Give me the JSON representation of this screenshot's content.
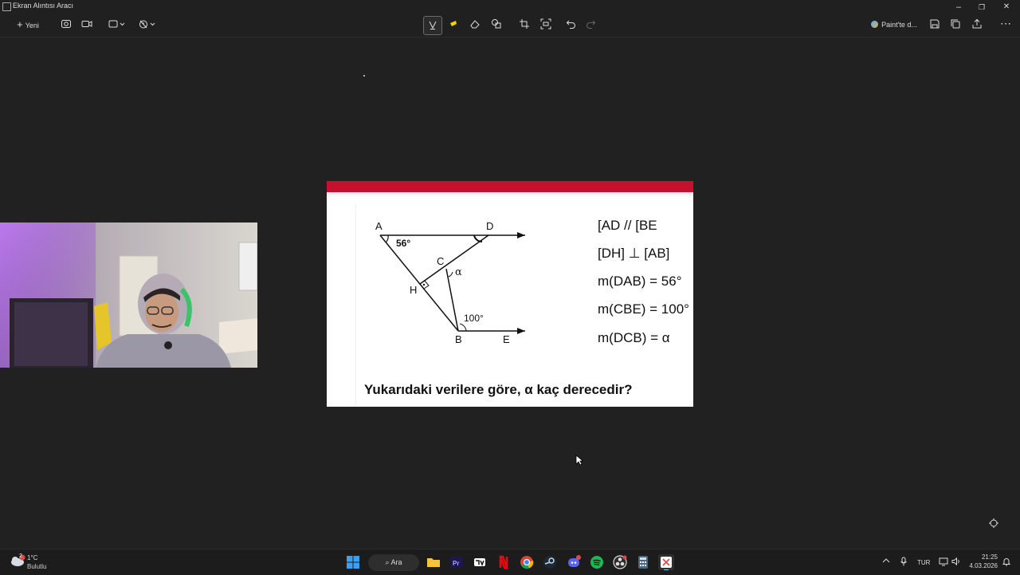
{
  "window": {
    "title": "Ekran Alıntısı Aracı",
    "controls": {
      "minimize": "–",
      "restore": "❐",
      "close": "✕"
    }
  },
  "toolbar": {
    "new_label": "Yeni",
    "paint_label": "Paint'te d...",
    "active_tool": "ballpoint-pen"
  },
  "question": {
    "diagram_labels": {
      "a": "A",
      "d": "D",
      "c": "C",
      "h": "H",
      "b": "B",
      "e": "E",
      "angle_a": "56°",
      "angle_b": "100°",
      "alpha": "α"
    },
    "conditions": [
      "[AD // [BE",
      "[DH] ⊥ [AB]",
      "m(DAB) = 56°",
      "m(CBE) = 100°",
      "m(DCB) = α"
    ],
    "prompt": "Yukarıdaki verilere göre,  α  kaç derecedir?"
  },
  "taskbar": {
    "weather": {
      "temperature": "1°C",
      "condition": "Bulutlu",
      "badge": "2"
    },
    "search_label": "Ara",
    "language": "TUR",
    "clock": {
      "time": "21:25",
      "date": "4.03.2026"
    }
  },
  "colors": {
    "background": "#202020",
    "accent_red": "#c8102e",
    "paper": "#ffffff"
  }
}
